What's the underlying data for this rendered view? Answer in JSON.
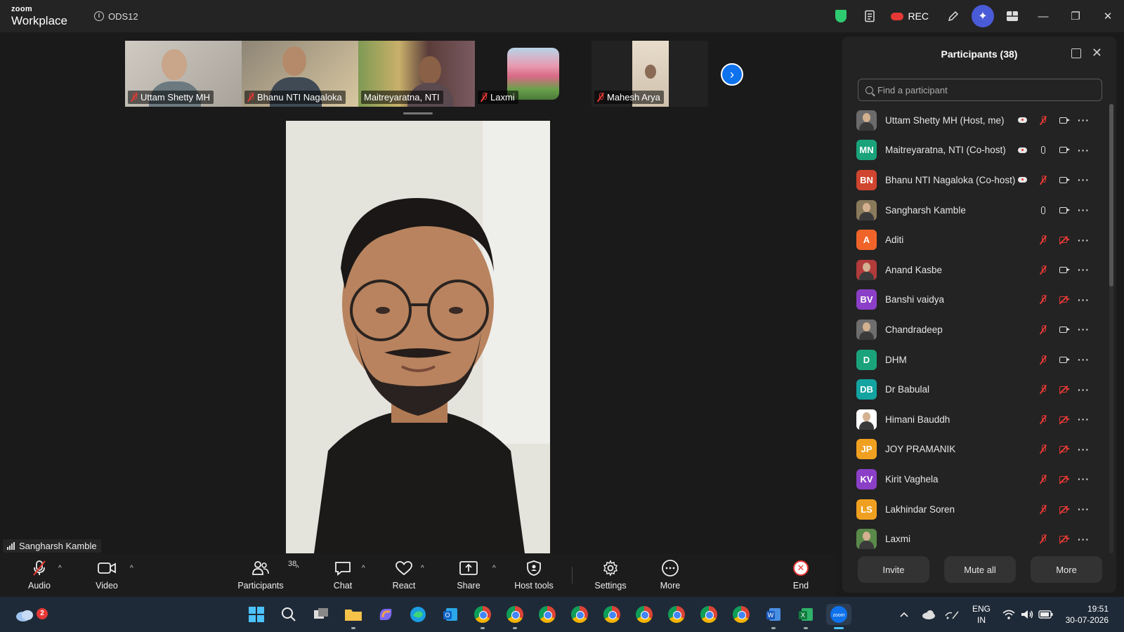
{
  "app": {
    "brand_top": "zoom",
    "brand_bottom": "Workplace",
    "meeting_id": "ODS12",
    "rec_label": "REC"
  },
  "thumbnails": [
    {
      "name": "Uttam Shetty MH",
      "muted": true
    },
    {
      "name": "Bhanu NTI Nagaloka",
      "muted": true
    },
    {
      "name": "Maitreyaratna, NTI",
      "muted": false
    },
    {
      "name": "Laxmi",
      "muted": true
    },
    {
      "name": "Mahesh Arya",
      "muted": true
    }
  ],
  "active_speaker": "Sangharsh Kamble",
  "panel": {
    "title": "Participants (38)",
    "search_placeholder": "Find a participant",
    "invite_label": "Invite",
    "mute_all_label": "Mute all",
    "more_label": "More"
  },
  "participants": [
    {
      "name": "Uttam Shetty MH (Host, me)",
      "initials": "",
      "color": "#6b6b6b",
      "rec": true,
      "mic": "off",
      "cam": "on"
    },
    {
      "name": "Maitreyaratna, NTI (Co-host)",
      "initials": "MN",
      "color": "#1aa37a",
      "rec": true,
      "mic": "on",
      "cam": "on"
    },
    {
      "name": "Bhanu NTI Nagaloka (Co-host)",
      "initials": "BN",
      "color": "#d0452f",
      "rec": true,
      "mic": "off",
      "cam": "on"
    },
    {
      "name": "Sangharsh Kamble",
      "initials": "",
      "color": "#8a7a5c",
      "rec": false,
      "mic": "on",
      "cam": "on"
    },
    {
      "name": "Aditi",
      "initials": "A",
      "color": "#f0642a",
      "rec": false,
      "mic": "off",
      "cam": "off"
    },
    {
      "name": "Anand Kasbe",
      "initials": "",
      "color": "#b23b3b",
      "rec": false,
      "mic": "off",
      "cam": "on"
    },
    {
      "name": "Banshi vaidya",
      "initials": "BV",
      "color": "#8b3fc7",
      "rec": false,
      "mic": "off",
      "cam": "off"
    },
    {
      "name": "Chandradeep",
      "initials": "",
      "color": "#6e6e6e",
      "rec": false,
      "mic": "off",
      "cam": "on"
    },
    {
      "name": "DHM",
      "initials": "D",
      "color": "#1aa37a",
      "rec": false,
      "mic": "off",
      "cam": "on"
    },
    {
      "name": "Dr Babulal",
      "initials": "DB",
      "color": "#13a3a0",
      "rec": false,
      "mic": "off",
      "cam": "off"
    },
    {
      "name": "Himani Bauddh",
      "initials": "",
      "color": "#ffffff",
      "rec": false,
      "mic": "off",
      "cam": "off"
    },
    {
      "name": "JOY PRAMANIK",
      "initials": "JP",
      "color": "#f0a020",
      "rec": false,
      "mic": "off",
      "cam": "off"
    },
    {
      "name": "Kirit Vaghela",
      "initials": "KV",
      "color": "#8b3fc7",
      "rec": false,
      "mic": "off",
      "cam": "off"
    },
    {
      "name": "Lakhindar Soren",
      "initials": "LS",
      "color": "#f0a020",
      "rec": false,
      "mic": "off",
      "cam": "off"
    },
    {
      "name": "Laxmi",
      "initials": "",
      "color": "#5a8a4a",
      "rec": false,
      "mic": "off",
      "cam": "off"
    }
  ],
  "toolbar": {
    "audio": "Audio",
    "video": "Video",
    "participants": "Participants",
    "participants_count": "38",
    "chat": "Chat",
    "react": "React",
    "share": "Share",
    "host_tools": "Host tools",
    "settings": "Settings",
    "more": "More",
    "end": "End"
  },
  "taskbar": {
    "notification_count": "2",
    "lang_top": "ENG",
    "lang_bottom": "IN",
    "time": "19:51",
    "date": "30-07-2026"
  },
  "colors": {
    "accent": "#0e72ed",
    "muted_red": "#e53935",
    "security_green": "#2ecc71"
  }
}
